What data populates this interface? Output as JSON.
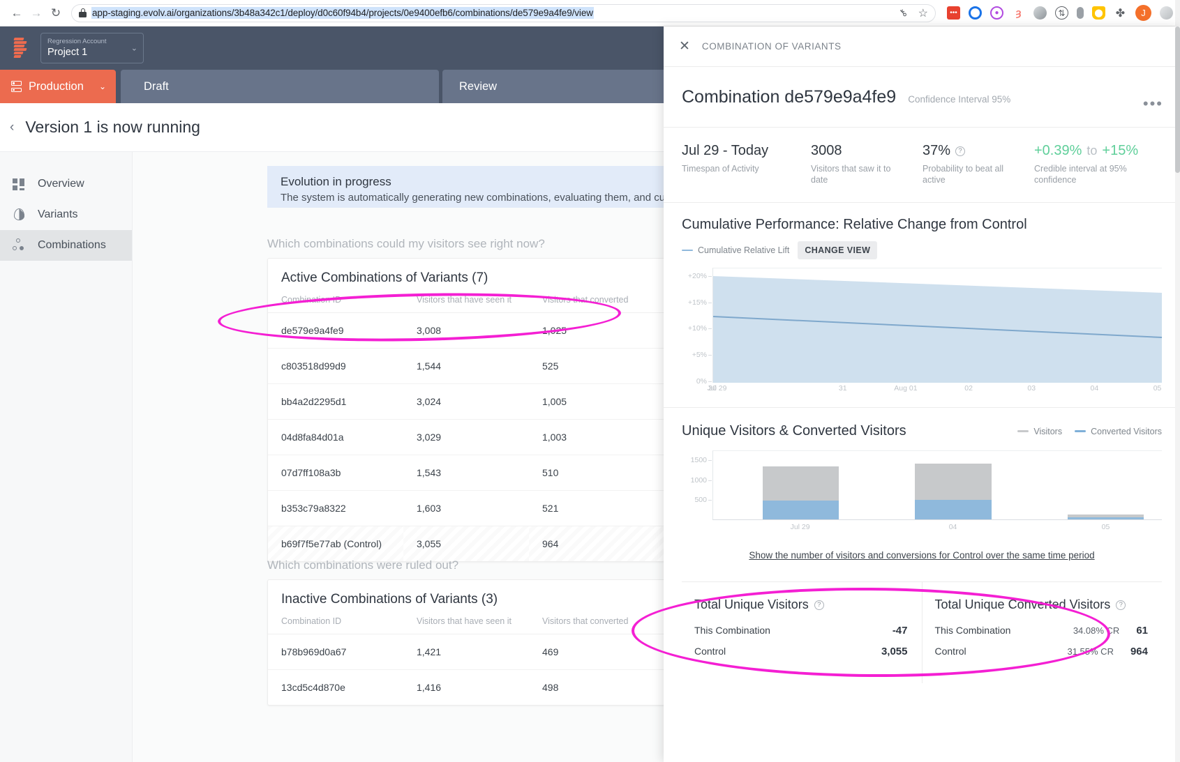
{
  "browser": {
    "url": "app-staging.evolv.ai/organizations/3b48a342c1/deploy/d0c60f94b4/projects/0e9400efb6/combinations/de579e9a4fe9/view",
    "back_glyph": "←",
    "forward_glyph": "→",
    "reload_glyph": "↻",
    "key_glyph": "⚷",
    "star_glyph": "☆",
    "extensions": [
      {
        "name": "extension-red",
        "color": "#e8412f",
        "glyph": "⋯",
        "shape": "sq"
      },
      {
        "name": "extension-blue-ring",
        "color": "#1a73e8",
        "glyph": "○",
        "shape": "circle"
      },
      {
        "name": "extension-purple-target",
        "color": "#b14ae0",
        "glyph": "◉",
        "shape": "circle"
      },
      {
        "name": "extension-salmon-g",
        "color": "#f77b72",
        "glyph": "g",
        "shape": "circle"
      },
      {
        "name": "extension-gray-sphere",
        "color": "#8e9499",
        "glyph": "●",
        "shape": "circle"
      },
      {
        "name": "extension-globe",
        "color": "#5f6368",
        "glyph": "⊕",
        "shape": "circle"
      },
      {
        "name": "extension-mouse",
        "color": "#9aa0a6",
        "glyph": "▮",
        "shape": "circle"
      },
      {
        "name": "extension-shield",
        "color": "#ffc400",
        "glyph": "⛨",
        "shape": "circle"
      },
      {
        "name": "extension-puzzle",
        "color": "#5f6368",
        "glyph": "✣",
        "shape": "circle"
      },
      {
        "name": "profile-avatar",
        "color": "#f4702a",
        "glyph": "J",
        "shape": "circle"
      },
      {
        "name": "chrome-menu",
        "color": "#c3c6c9",
        "glyph": "●",
        "shape": "circle"
      }
    ]
  },
  "topnav": {
    "account_label": "Regression Account",
    "project_name": "Project 1",
    "chevron": "⌄"
  },
  "env_tabs": [
    {
      "key": "production",
      "label": "Production",
      "chevron": "⌄"
    },
    {
      "key": "draft",
      "label": "Draft"
    },
    {
      "key": "review",
      "label": "Review"
    }
  ],
  "subheader": {
    "back_glyph": "‹",
    "title": "Version 1 is now running"
  },
  "sidebar": {
    "items": [
      {
        "label": "Overview",
        "icon": "overview-grid-icon"
      },
      {
        "label": "Variants",
        "icon": "variants-droplet-icon"
      },
      {
        "label": "Combinations",
        "icon": "combinations-dots-icon"
      }
    ],
    "active_index": 2
  },
  "main": {
    "banner": {
      "title": "Evolution in progress",
      "description": "The system is automatically generating new combinations, evaluating them, and cu"
    },
    "question_active": "Which combinations could my visitors see right now?",
    "question_inactive": "Which combinations were ruled out?",
    "active_card": {
      "title": "Active Combinations of Variants (7)",
      "columns": [
        "Combination ID",
        "Visitors that have seen it",
        "Visitors that converted"
      ],
      "rows": [
        {
          "id": "de579e9a4fe9",
          "seen": "3,008",
          "converted": "1,025",
          "control": false
        },
        {
          "id": "c803518d99d9",
          "seen": "1,544",
          "converted": "525",
          "control": false
        },
        {
          "id": "bb4a2d2295d1",
          "seen": "3,024",
          "converted": "1,005",
          "control": false
        },
        {
          "id": "04d8fa84d01a",
          "seen": "3,029",
          "converted": "1,003",
          "control": false
        },
        {
          "id": "07d7ff108a3b",
          "seen": "1,543",
          "converted": "510",
          "control": false
        },
        {
          "id": "b353c79a8322",
          "seen": "1,603",
          "converted": "521",
          "control": false
        },
        {
          "id": "b69f7f5e77ab (Control)",
          "seen": "3,055",
          "converted": "964",
          "control": true
        }
      ]
    },
    "inactive_card": {
      "title": "Inactive Combinations of Variants (3)",
      "columns": [
        "Combination ID",
        "Visitors that have seen it",
        "Visitors that converted"
      ],
      "rows": [
        {
          "id": "b78b969d0a67",
          "seen": "1,421",
          "converted": "469"
        },
        {
          "id": "13cd5c4d870e",
          "seen": "1,416",
          "converted": "498"
        }
      ]
    }
  },
  "panel": {
    "close_glyph": "✕",
    "eyebrow": "COMBINATION OF VARIANTS",
    "title": "Combination de579e9a4fe9",
    "confidence_interval": "Confidence Interval 95%",
    "more_glyph": "•••",
    "stats": [
      {
        "value": "Jul 29 - Today",
        "sub": "Timespan of Activity",
        "help": false,
        "accent": false
      },
      {
        "value": "3008",
        "sub": "Visitors that saw it to date",
        "help": false,
        "accent": false
      },
      {
        "value": "37%",
        "sub": "Probability to beat all active",
        "help": true,
        "accent": false
      },
      {
        "value": "+0.39%",
        "value2": "+15%",
        "joiner": "to",
        "sub": "Credible interval at 95% confidence",
        "help": false,
        "accent": true
      }
    ],
    "line_section": {
      "heading": "Cumulative Performance: Relative Change from Control",
      "legend_label": "Cumulative Relative Lift",
      "legend_color": "#8fb9dc",
      "change_view_label": "CHANGE VIEW"
    },
    "bar_section": {
      "heading": "Unique Visitors & Converted Visitors",
      "legend": [
        {
          "label": "Visitors",
          "color": "#c7c9cb"
        },
        {
          "label": "Converted Visitors",
          "color": "#7fb0d8"
        }
      ],
      "show_link": "Show the number of visitors and conversions for Control over the same time period"
    },
    "totals": [
      {
        "heading": "Total Unique Visitors",
        "help": true,
        "rows": [
          {
            "label": "This Combination",
            "cr": "",
            "value": "-47"
          },
          {
            "label": "Control",
            "cr": "",
            "value": "3,055"
          }
        ]
      },
      {
        "heading": "Total Unique Converted Visitors",
        "help": true,
        "rows": [
          {
            "label": "This Combination",
            "cr": "34.08% CR",
            "value": "61"
          },
          {
            "label": "Control",
            "cr": "31.55% CR",
            "value": "964"
          }
        ]
      }
    ]
  },
  "chart_data": [
    {
      "type": "area",
      "name": "cumulative-relative-lift",
      "title": "Cumulative Performance: Relative Change from Control",
      "xlabel": "",
      "ylabel": "",
      "ylim": [
        0,
        22
      ],
      "ytick_labels": [
        "+20%",
        "+15%",
        "+10%",
        "+5%",
        "0%"
      ],
      "ytick_values": [
        20,
        15,
        10,
        5,
        0
      ],
      "x": [
        "Jul 29",
        "30",
        "31",
        "Aug 01",
        "02",
        "03",
        "04",
        "05"
      ],
      "series": [
        {
          "name": "Cumulative Relative Lift",
          "color": "#8fb9dc",
          "values": [
            12.6,
            12.0,
            11.5,
            11.0,
            10.5,
            10.0,
            9.4,
            8.8
          ]
        },
        {
          "name": "Upper bound (95%)",
          "color": "#cfe0ee",
          "values": [
            20.5,
            19.8,
            19.2,
            18.5,
            17.8,
            17.2,
            16.5,
            16.0
          ]
        },
        {
          "name": "Lower bound (95%)",
          "color": "#cfe0ee",
          "values": [
            0.0,
            0.0,
            0.0,
            0.0,
            0.0,
            0.0,
            0.0,
            0.0
          ]
        }
      ],
      "grid": false,
      "legend_position": "top-left"
    },
    {
      "type": "bar",
      "name": "unique-visitors-and-converted-visitors",
      "title": "Unique Visitors & Converted Visitors",
      "stacked": true,
      "categories": [
        "Jul 29",
        "04",
        "05"
      ],
      "ylim": [
        0,
        1750
      ],
      "ytick_labels": [
        "1500",
        "1000",
        "500"
      ],
      "ytick_values": [
        1500,
        1000,
        500
      ],
      "series": [
        {
          "name": "Visitors",
          "color": "#c7c9cb",
          "values": [
            1370,
            1440,
            105
          ]
        },
        {
          "name": "Converted Visitors",
          "color": "#7fb0d8",
          "values": [
            480,
            500,
            35
          ]
        }
      ],
      "grid": false,
      "legend_position": "top-right"
    }
  ],
  "annotations": [
    {
      "name": "highlight-active-row",
      "shape": "ellipse",
      "color": "#f41fd3"
    },
    {
      "name": "highlight-totals",
      "shape": "ellipse",
      "color": "#f41fd3"
    }
  ]
}
